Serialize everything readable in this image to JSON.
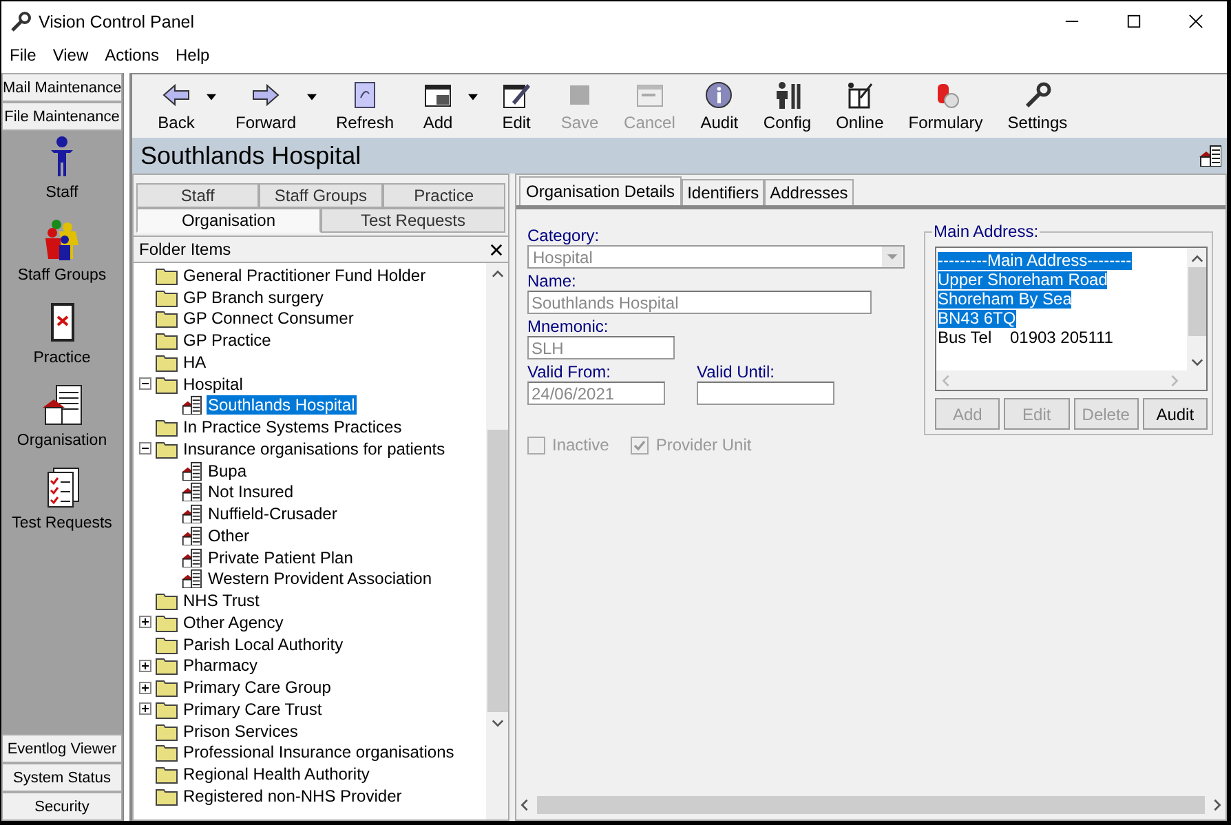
{
  "window": {
    "title": "Vision Control Panel"
  },
  "menu": [
    "File",
    "View",
    "Actions",
    "Help"
  ],
  "sidebar": {
    "top_buttons": [
      "Mail Maintenance",
      "File Maintenance"
    ],
    "items": [
      "Staff",
      "Staff Groups",
      "Practice",
      "Organisation",
      "Test Requests"
    ],
    "bottom_buttons": [
      "Eventlog Viewer",
      "System Status",
      "Security"
    ]
  },
  "toolbar": [
    {
      "label": "Back",
      "disabled": false,
      "dropdown": true
    },
    {
      "label": "Forward",
      "disabled": false,
      "dropdown": true
    },
    {
      "label": "Refresh",
      "disabled": false,
      "dropdown": false
    },
    {
      "label": "Add",
      "disabled": false,
      "dropdown": true
    },
    {
      "label": "Edit",
      "disabled": false,
      "dropdown": false
    },
    {
      "label": "Save",
      "disabled": true,
      "dropdown": false
    },
    {
      "label": "Cancel",
      "disabled": true,
      "dropdown": false
    },
    {
      "label": "Audit",
      "disabled": false,
      "dropdown": false
    },
    {
      "label": "Config",
      "disabled": false,
      "dropdown": false
    },
    {
      "label": "Online",
      "disabled": false,
      "dropdown": false
    },
    {
      "label": "Formulary",
      "disabled": false,
      "dropdown": false
    },
    {
      "label": "Settings",
      "disabled": false,
      "dropdown": false
    }
  ],
  "heading": "Southlands Hospital",
  "folder_tabs": [
    [
      {
        "label": "Staff",
        "selected": false
      },
      {
        "label": "Staff Groups",
        "selected": false
      },
      {
        "label": "Practice",
        "selected": false
      }
    ],
    [
      {
        "label": "Organisation",
        "selected": true
      },
      {
        "label": "Test Requests",
        "selected": false
      }
    ]
  ],
  "folder_header": "Folder Items",
  "tree": [
    {
      "label": "General Practitioner Fund Holder",
      "kind": "folder",
      "selected": false
    },
    {
      "label": "GP Branch surgery",
      "kind": "folder",
      "selected": false
    },
    {
      "label": "GP Connect Consumer",
      "kind": "folder",
      "selected": false
    },
    {
      "label": "GP Practice",
      "kind": "folder",
      "selected": false
    },
    {
      "label": "HA",
      "kind": "folder",
      "selected": false
    },
    {
      "label": "Hospital",
      "kind": "folder",
      "selected": false,
      "expanded": true,
      "children": [
        {
          "label": "Southlands Hospital",
          "kind": "organisation",
          "selected": true
        }
      ]
    },
    {
      "label": "In Practice Systems Practices",
      "kind": "folder",
      "selected": false
    },
    {
      "label": "Insurance organisations for patients",
      "kind": "folder",
      "selected": false,
      "expanded": true,
      "children": [
        {
          "label": "Bupa",
          "kind": "organisation",
          "selected": false
        },
        {
          "label": "Not Insured",
          "kind": "organisation",
          "selected": false
        },
        {
          "label": "Nuffield-Crusader",
          "kind": "organisation",
          "selected": false
        },
        {
          "label": "Other",
          "kind": "organisation",
          "selected": false
        },
        {
          "label": "Private Patient Plan",
          "kind": "organisation",
          "selected": false
        },
        {
          "label": "Western Provident Association",
          "kind": "organisation",
          "selected": false
        }
      ]
    },
    {
      "label": "NHS Trust",
      "kind": "folder",
      "selected": false
    },
    {
      "label": "Other Agency",
      "kind": "folder",
      "selected": false,
      "expanded": false
    },
    {
      "label": "Parish Local Authority",
      "kind": "folder",
      "selected": false
    },
    {
      "label": "Pharmacy",
      "kind": "folder",
      "selected": false,
      "expanded": false
    },
    {
      "label": "Primary Care Group",
      "kind": "folder",
      "selected": false,
      "expanded": false
    },
    {
      "label": "Primary Care Trust",
      "kind": "folder",
      "selected": false,
      "expanded": false
    },
    {
      "label": "Prison Services",
      "kind": "folder",
      "selected": false
    },
    {
      "label": "Professional Insurance organisations",
      "kind": "folder",
      "selected": false
    },
    {
      "label": "Regional Health Authority",
      "kind": "folder",
      "selected": false
    },
    {
      "label": "Registered non-NHS Provider",
      "kind": "folder",
      "selected": false
    }
  ],
  "detail_tabs": [
    {
      "label": "Organisation Details",
      "selected": true
    },
    {
      "label": "Identifiers",
      "selected": false
    },
    {
      "label": "Addresses",
      "selected": false
    }
  ],
  "form": {
    "category": {
      "label": "Category:",
      "value": "Hospital",
      "disabled": true
    },
    "name": {
      "label": "Name:",
      "value": "Southlands Hospital",
      "disabled": true
    },
    "mnemonic": {
      "label": "Mnemonic:",
      "value": "SLH",
      "disabled": true
    },
    "valid_from": {
      "label": "Valid From:",
      "value": "24/06/2021",
      "disabled": true
    },
    "valid_until": {
      "label": "Valid Until:"
    },
    "checkboxes": [
      {
        "label": "Inactive",
        "checked": false,
        "disabled": true
      },
      {
        "label": "Provider Unit",
        "checked": true,
        "disabled": true
      }
    ]
  },
  "address": {
    "title": "Main Address:",
    "lines": [
      {
        "text": "---------Main Address--------",
        "selected": true
      },
      {
        "text": "Upper Shoreham Road",
        "selected": true
      },
      {
        "text": "Shoreham By Sea",
        "selected": true
      },
      {
        "text": "BN43 6TQ",
        "selected": true
      },
      {
        "text": "Bus Tel    01903 205111",
        "selected": false
      }
    ],
    "buttons": [
      {
        "label": "Add",
        "disabled": true
      },
      {
        "label": "Edit",
        "disabled": true
      },
      {
        "label": "Delete",
        "disabled": true
      },
      {
        "label": "Audit",
        "disabled": false
      }
    ]
  }
}
